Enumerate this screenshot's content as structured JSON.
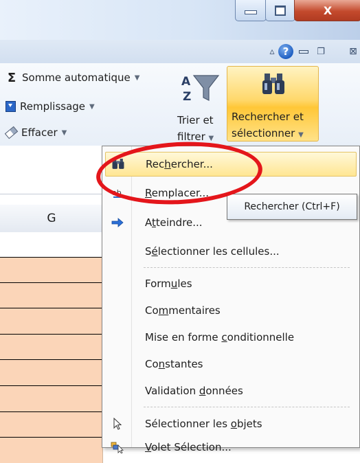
{
  "window": {
    "minimize_glyph": "–",
    "close_glyph": "X"
  },
  "ribbon_top": {
    "help_glyph": "?",
    "close_glyph": "⊠"
  },
  "ribbon": {
    "autosum_label": "Somme automatique",
    "fill_label": "Remplissage",
    "clear_label": "Effacer",
    "sort_filter_label_line1": "Trier et",
    "sort_filter_label_line2": "filtrer",
    "find_select_label_line1": "Rechercher et",
    "find_select_label_line2": "sélectionner"
  },
  "sheet": {
    "column_header": "G",
    "cell_fill_color": "#fbd5b8"
  },
  "menu": {
    "items": [
      {
        "pre": "Rec",
        "key": "h",
        "post": "ercher...",
        "icon": "binoculars-icon"
      },
      {
        "pre": "",
        "key": "R",
        "post": "emplacer...",
        "icon": "replace-icon"
      },
      {
        "pre": "A",
        "key": "t",
        "post": "teindre...",
        "icon": "arrow-right-icon"
      },
      {
        "pre": "S",
        "key": "é",
        "post": "lectionner les cellules...",
        "icon": ""
      },
      {
        "pre": "Form",
        "key": "u",
        "post": "les",
        "icon": ""
      },
      {
        "pre": "Co",
        "key": "m",
        "post": "mentaires",
        "icon": ""
      },
      {
        "pre": "Mise en forme ",
        "key": "c",
        "post": "onditionnelle",
        "icon": ""
      },
      {
        "pre": "Co",
        "key": "n",
        "post": "stantes",
        "icon": ""
      },
      {
        "pre": "Validation ",
        "key": "d",
        "post": "onnées",
        "icon": ""
      },
      {
        "pre": "Sélectionner les ",
        "key": "o",
        "post": "bjets",
        "icon": "select-objects-icon"
      },
      {
        "pre": "",
        "key": "V",
        "post": "olet Sélection...",
        "icon": "selection-pane-icon"
      }
    ]
  },
  "tooltip": {
    "text": "Rechercher (Ctrl+F)"
  },
  "colors": {
    "highlight_circle": "#e4161b",
    "button_active": "#ffc737"
  }
}
